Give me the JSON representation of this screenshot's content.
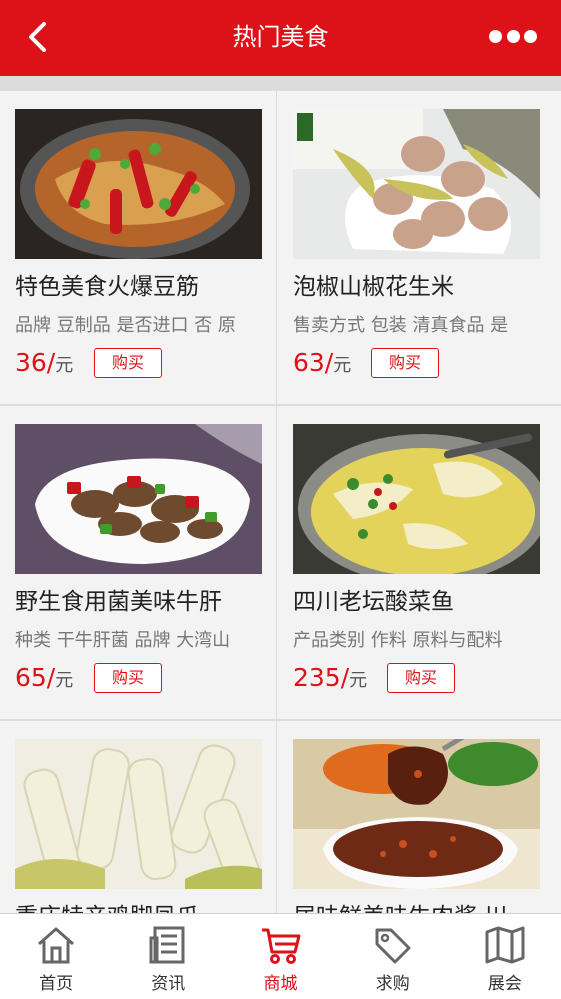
{
  "header": {
    "title": "热门美食",
    "back_icon": "chevron-left-icon",
    "more_icon": "more-dots-icon"
  },
  "products": [
    {
      "name": "特色美食火爆豆筋",
      "attrs": "品牌 豆制品 是否进口 否 原",
      "price": "36/",
      "unit": "元",
      "buy_label": "购买"
    },
    {
      "name": "泡椒山椒花生米",
      "attrs": "售卖方式 包装 清真食品 是",
      "price": "63/",
      "unit": "元",
      "buy_label": "购买"
    },
    {
      "name": "野生食用菌美味牛肝",
      "attrs": "种类 干牛肝菌 品牌 大湾山",
      "price": "65/",
      "unit": "元",
      "buy_label": "购买"
    },
    {
      "name": "四川老坛酸菜鱼",
      "attrs": "产品类别 作料 原料与配料",
      "price": "235/",
      "unit": "元",
      "buy_label": "购买"
    },
    {
      "name": "重庆特产鸡脚凤爪",
      "attrs": "",
      "price": "",
      "unit": "",
      "buy_label": ""
    },
    {
      "name": "居味鲜美味牛肉酱 川",
      "attrs": "",
      "price": "",
      "unit": "",
      "buy_label": ""
    }
  ],
  "tabbar": {
    "items": [
      {
        "label": "首页",
        "icon": "home-icon"
      },
      {
        "label": "资讯",
        "icon": "news-icon"
      },
      {
        "label": "商城",
        "icon": "cart-icon",
        "active": true
      },
      {
        "label": "求购",
        "icon": "tag-icon"
      },
      {
        "label": "展会",
        "icon": "map-icon"
      }
    ]
  },
  "colors": {
    "accent": "#dd1118",
    "background": "#ececec",
    "card": "#f3f3f3"
  }
}
